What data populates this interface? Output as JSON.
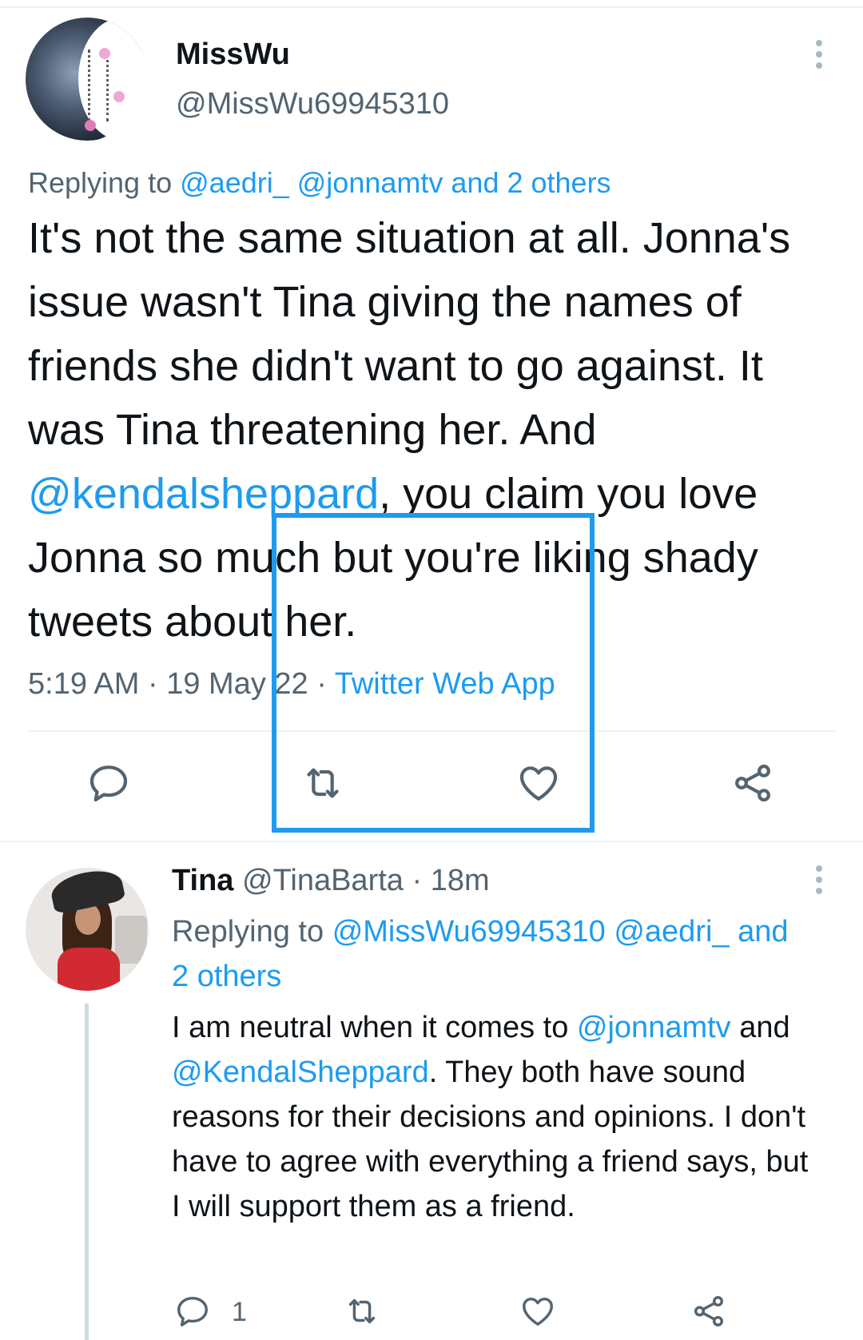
{
  "main_tweet": {
    "display_name": "MissWu",
    "handle": "@MissWu69945310",
    "replying_label": "Replying to",
    "replying_mention_1": "@aedri_",
    "replying_mention_2": "@jonnamtv",
    "replying_others": "and 2 others",
    "text_part_1": "It's not the same situation at all. Jonna's issue wasn't Tina giving the names of friends she didn't want to go against. It was Tina threatening her. And ",
    "text_mention": "@kendalsheppard",
    "text_part_2": ", you claim you love Jonna so much but you're liking shady tweets about her.",
    "time": "5:19 AM",
    "separator": "·",
    "date": "19 May 22",
    "source": "Twitter Web App",
    "actions": {
      "reply_icon": "reply-icon",
      "retweet_icon": "retweet-icon",
      "like_icon": "like-icon",
      "share_icon": "share-icon"
    }
  },
  "reply_tweet": {
    "display_name": "Tina",
    "handle": "@TinaBarta",
    "separator": "·",
    "time_ago": "18m",
    "replying_label": "Replying to",
    "replying_mention_1": "@MissWu69945310",
    "replying_mention_2": "@aedri_",
    "replying_others": "and 2 others",
    "text_part_1": "I am neutral when it comes to ",
    "text_mention_1": "@jonnamtv",
    "text_part_2": " and ",
    "text_mention_2": "@KendalSheppard",
    "text_part_3": ".  They both have sound reasons for their decisions and opinions.  I don't have to agree with everything a friend says, but I will support them as a friend.",
    "reply_count": "1"
  },
  "colors": {
    "accent": "#1d9bf0",
    "secondary_text": "#536471",
    "divider": "#eff3f4",
    "icon": "#536471"
  }
}
